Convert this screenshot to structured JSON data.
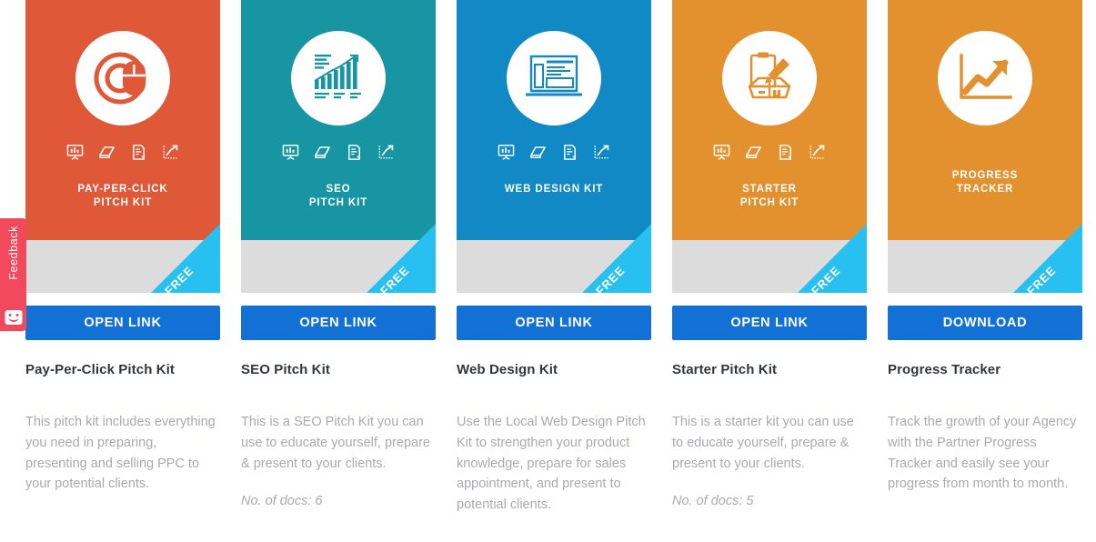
{
  "feedback": {
    "label": "Feedback",
    "face_icon": "smiley-face-icon",
    "color": "#f2495c"
  },
  "theme": {
    "button_blue": "#1371d6",
    "ribbon_cyan": "#27c0f0",
    "cover_band_gray": "#dcdcdc",
    "title_color": "#2f3640",
    "desc_color": "#a9aab0"
  },
  "ribbon_label": "FREE",
  "mini_icons": [
    "presentation-icon",
    "book-icon",
    "document-icon",
    "growth-chart-icon"
  ],
  "cards": [
    {
      "cover_title_line1": "PAY-PER-CLICK",
      "cover_title_line2": "PITCH KIT",
      "cover_color": "#df5838",
      "main_icon": "mouse-click-icon",
      "has_mini_icons": true,
      "ribbon": "FREE",
      "button_label": "OPEN LINK",
      "title": "Pay-Per-Click Pitch Kit",
      "description": "This pitch kit includes everything you need in preparing, presenting and selling PPC to your potential clients.",
      "docs": ""
    },
    {
      "cover_title_line1": "SEO",
      "cover_title_line2": "PITCH KIT",
      "cover_color": "#1795a3",
      "main_icon": "bar-chart-growth-icon",
      "has_mini_icons": true,
      "ribbon": "FREE",
      "button_label": "OPEN LINK",
      "title": "SEO Pitch Kit",
      "description": "This is a SEO Pitch Kit you can use to educate yourself, prepare & present to your clients.",
      "docs": "No. of docs: 6"
    },
    {
      "cover_title_line1": "WEB DESIGN KIT",
      "cover_title_line2": "",
      "cover_color": "#1089c4",
      "main_icon": "webpage-layout-icon",
      "has_mini_icons": true,
      "ribbon": "FREE",
      "button_label": "OPEN LINK",
      "title": "Web Design Kit",
      "description": "Use the Local Web Design Pitch Kit to strengthen your product knowledge, prepare for sales appointment, and present to potential clients.",
      "docs": ""
    },
    {
      "cover_title_line1": "STARTER",
      "cover_title_line2": "PITCH KIT",
      "cover_color": "#e3912f",
      "main_icon": "clipboard-box-icon",
      "has_mini_icons": true,
      "ribbon": "FREE",
      "button_label": "OPEN LINK",
      "title": "Starter Pitch Kit",
      "description": "This is a starter kit you can use to educate yourself, prepare & present to your clients.",
      "docs": "No. of docs: 5"
    },
    {
      "cover_title_line1": "PROGRESS",
      "cover_title_line2": "TRACKER",
      "cover_color": "#e3912f",
      "main_icon": "trend-arrow-chart-icon",
      "has_mini_icons": false,
      "ribbon": "FREE",
      "button_label": "DOWNLOAD",
      "title": "Progress Tracker",
      "description": "Track the growth of your Agency with the Partner Progress Tracker and easily see your progress from month to month.",
      "docs": ""
    }
  ]
}
